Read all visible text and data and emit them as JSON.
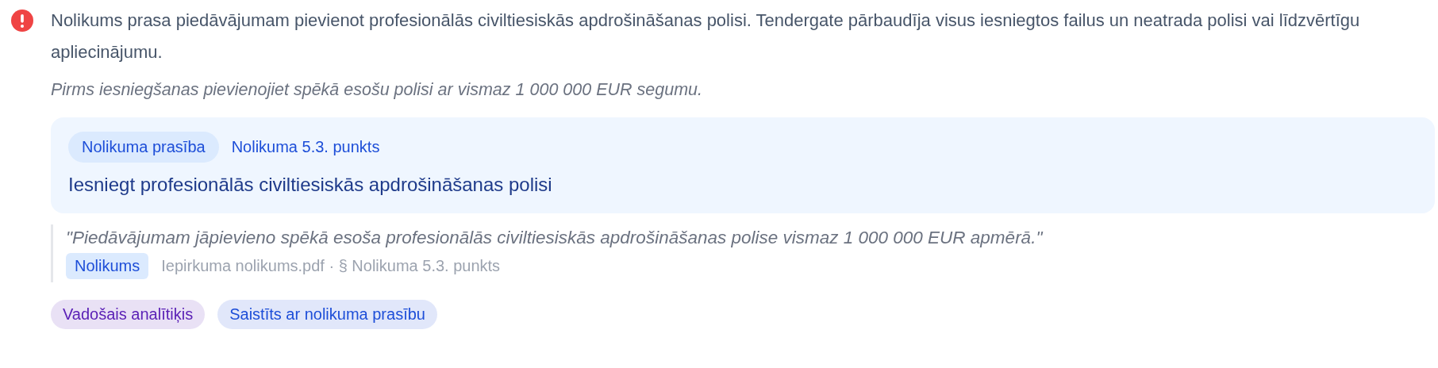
{
  "finding": {
    "kind": "error",
    "message": "Nolikums prasa piedāvājumam pievienot profesionālās civiltiesiskās apdrošināšanas polisi. Tendergate pārbaudīja visus iesniegtos failus un neatrada polisi vai līdzvērtīgu apliecinājumu.",
    "recommendation": "Pirms iesniegšanas pievienojiet spēkā esošu polisi ar vismaz 1 000 000 EUR segumu."
  },
  "requirement": {
    "badge": "Nolikuma prasība",
    "reference": "Nolikuma 5.3. punkts",
    "text": "Iesniegt profesionālās civiltiesiskās apdrošināšanas polisi"
  },
  "quote": {
    "text": "\"Piedāvājumam jāpievieno spēkā esoša profesionālās civiltiesiskās apdrošināšanas polise vismaz 1 000 000 EUR apmērā.\"",
    "source_badge": "Nolikums",
    "source": "Iepirkuma nolikums.pdf · § Nolikuma 5.3. punkts"
  },
  "tags": [
    {
      "label": "Vadošais analītiķis",
      "color": "#5b21b6"
    },
    {
      "label": "Saistīts ar nolikuma prasību",
      "color": "#1d4ed8"
    }
  ]
}
